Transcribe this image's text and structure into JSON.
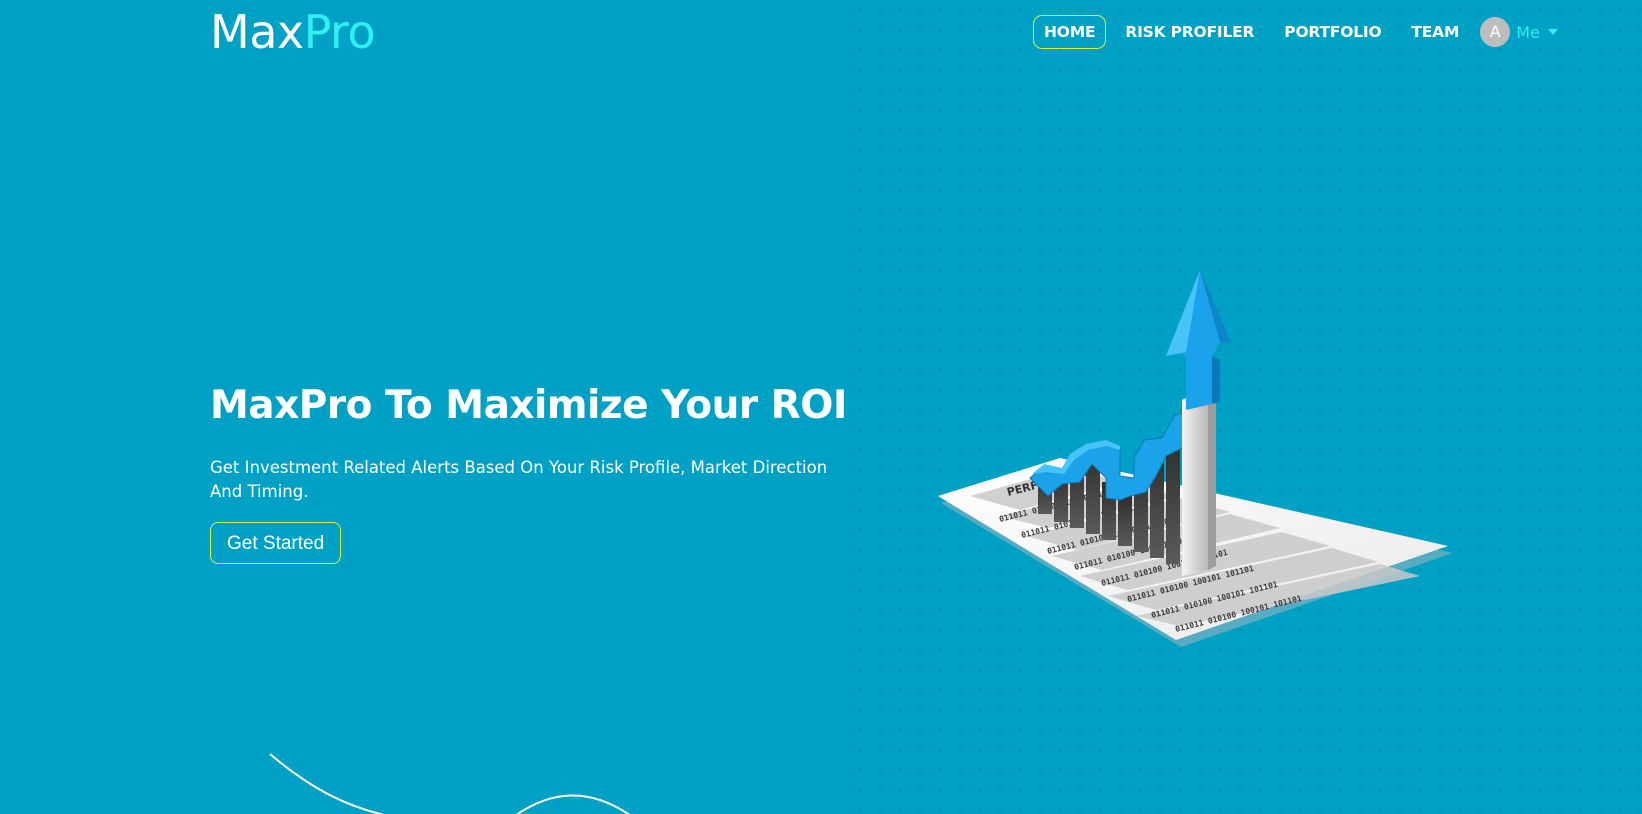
{
  "brand": {
    "part1": "Max",
    "part2": "Pro"
  },
  "nav": {
    "items": [
      {
        "label": "HOME",
        "active": true
      },
      {
        "label": "RISK PROFILER",
        "active": false
      },
      {
        "label": "PORTFOLIO",
        "active": false
      },
      {
        "label": "TEAM",
        "active": false
      }
    ],
    "user": {
      "initial": "A",
      "label": "Me"
    }
  },
  "hero": {
    "title": "MaxPro To Maximize Your ROI",
    "subtitle": "Get Investment Related Alerts Based On Your Risk Profile, Market Direction And Timing.",
    "cta": "Get Started"
  },
  "illustration": {
    "paper_title": "PERFORMANCE",
    "binary_rows": [
      "011011  010100  100101  101101",
      "011011  010100  100101  101101",
      "011011  010100  100101  101101",
      "011011  010100  100101  101101",
      "011011  010100  100101  101101",
      "011011  010100  100101  101101",
      "011011  010100  100101  101101",
      "011011  010100  100101  101101",
      "011011  010100  100101  101101"
    ]
  },
  "colors": {
    "background": "#00a1c4",
    "accent_cyan": "#2ff0f5",
    "active_border": "#d7f23a",
    "chart_blue": "#1aa3ea"
  }
}
